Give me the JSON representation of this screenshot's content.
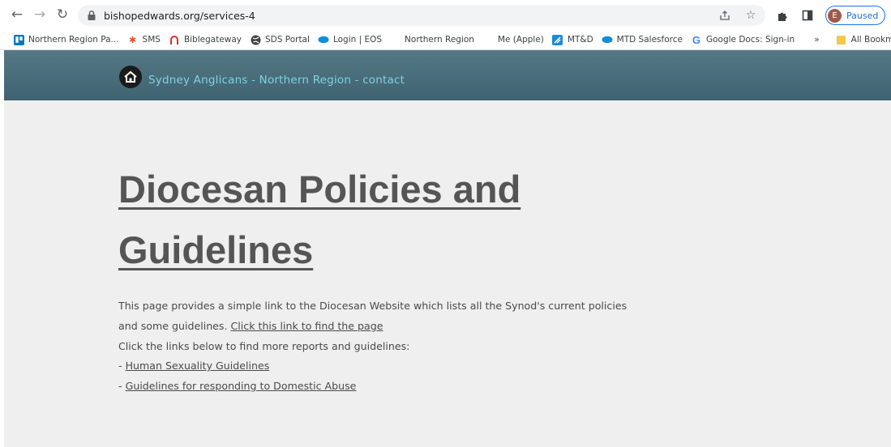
{
  "browser": {
    "url": "bishopedwards.org/services-4",
    "profile_initial": "E",
    "profile_status": "Paused",
    "accent": "#1a73e8",
    "icons": [
      "back-icon",
      "forward-icon",
      "reload-icon",
      "lock-icon",
      "share-icon",
      "star-icon",
      "extensions-icon",
      "side-panel-icon",
      "more-icon"
    ]
  },
  "bookmarks": {
    "items": [
      {
        "label": "Northern Region Pa...",
        "icon": "trello-icon"
      },
      {
        "label": "SMS",
        "icon": "sms-icon"
      },
      {
        "label": "Biblegateway",
        "icon": "biblegateway-icon"
      },
      {
        "label": "SDS Portal",
        "icon": "globe-icon"
      },
      {
        "label": "Login | EOS",
        "icon": "salesforce-icon"
      },
      {
        "label": "Northern Region",
        "icon": ""
      },
      {
        "label": "Me (Apple)",
        "icon": "apple-icon"
      },
      {
        "label": "MT&D",
        "icon": "mtd-icon"
      },
      {
        "label": "MTD Salesforce",
        "icon": "salesforce-icon"
      },
      {
        "label": "Google Docs: Sign-in",
        "icon": "google-icon"
      }
    ],
    "overflow": "»",
    "all_bookmarks": "All Bookmarks"
  },
  "site": {
    "header_color": "#4a6e7b",
    "brand_color": "#7fd3de",
    "brand_name": "Sydney Anglicans - Northern Region",
    "nav_link": " - contact"
  },
  "content": {
    "title_line1": "Diocesan Policies and",
    "title_line2": "Guidelines",
    "para_line1": "This page provides a simple link to the Diocesan Website which lists all the Synod's current policies",
    "para_line2_prefix": "and some guidelines. ",
    "para_link": "Click this link to find the page",
    "para_line3": "Click the links below to find more reports and guidelines:",
    "dash": "- ",
    "link1": "Human Sexuality Guidelines",
    "link2": "Guidelines for responding to Domestic Abuse"
  }
}
